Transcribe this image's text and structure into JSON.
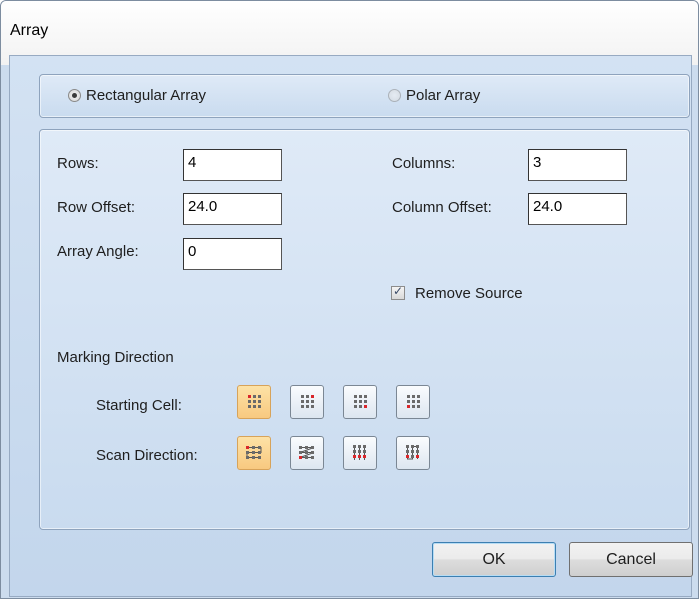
{
  "window": {
    "title": "Array"
  },
  "array_type": {
    "options": [
      "Rectangular Array",
      "Polar Array"
    ],
    "selected": "Rectangular Array"
  },
  "fields": {
    "rows": {
      "label": "Rows:",
      "value": "4"
    },
    "columns": {
      "label": "Columns:",
      "value": "3"
    },
    "row_offset": {
      "label": "Row Offset:",
      "value": "24.0"
    },
    "column_offset": {
      "label": "Column Offset:",
      "value": "24.0"
    },
    "array_angle": {
      "label": "Array Angle:",
      "value": "0"
    }
  },
  "remove_source": {
    "label": "Remove Source",
    "checked": true
  },
  "marking": {
    "heading": "Marking Direction",
    "starting_cell": {
      "label": "Starting Cell:",
      "options": [
        "top-left",
        "top-right",
        "bottom-right",
        "bottom-left"
      ],
      "selected": "top-left"
    },
    "scan_direction": {
      "label": "Scan Direction:",
      "options": [
        "horizontal-zigzag",
        "horizontal-return",
        "vertical-zigzag",
        "vertical-return"
      ],
      "selected": "horizontal-zigzag"
    }
  },
  "buttons": {
    "ok": "OK",
    "cancel": "Cancel"
  },
  "colors": {
    "dialog_bg": "#ccdcee",
    "selected_button": "#f8c980",
    "marker_red": "#d9262a",
    "dot_gray": "#6a6a6a"
  }
}
